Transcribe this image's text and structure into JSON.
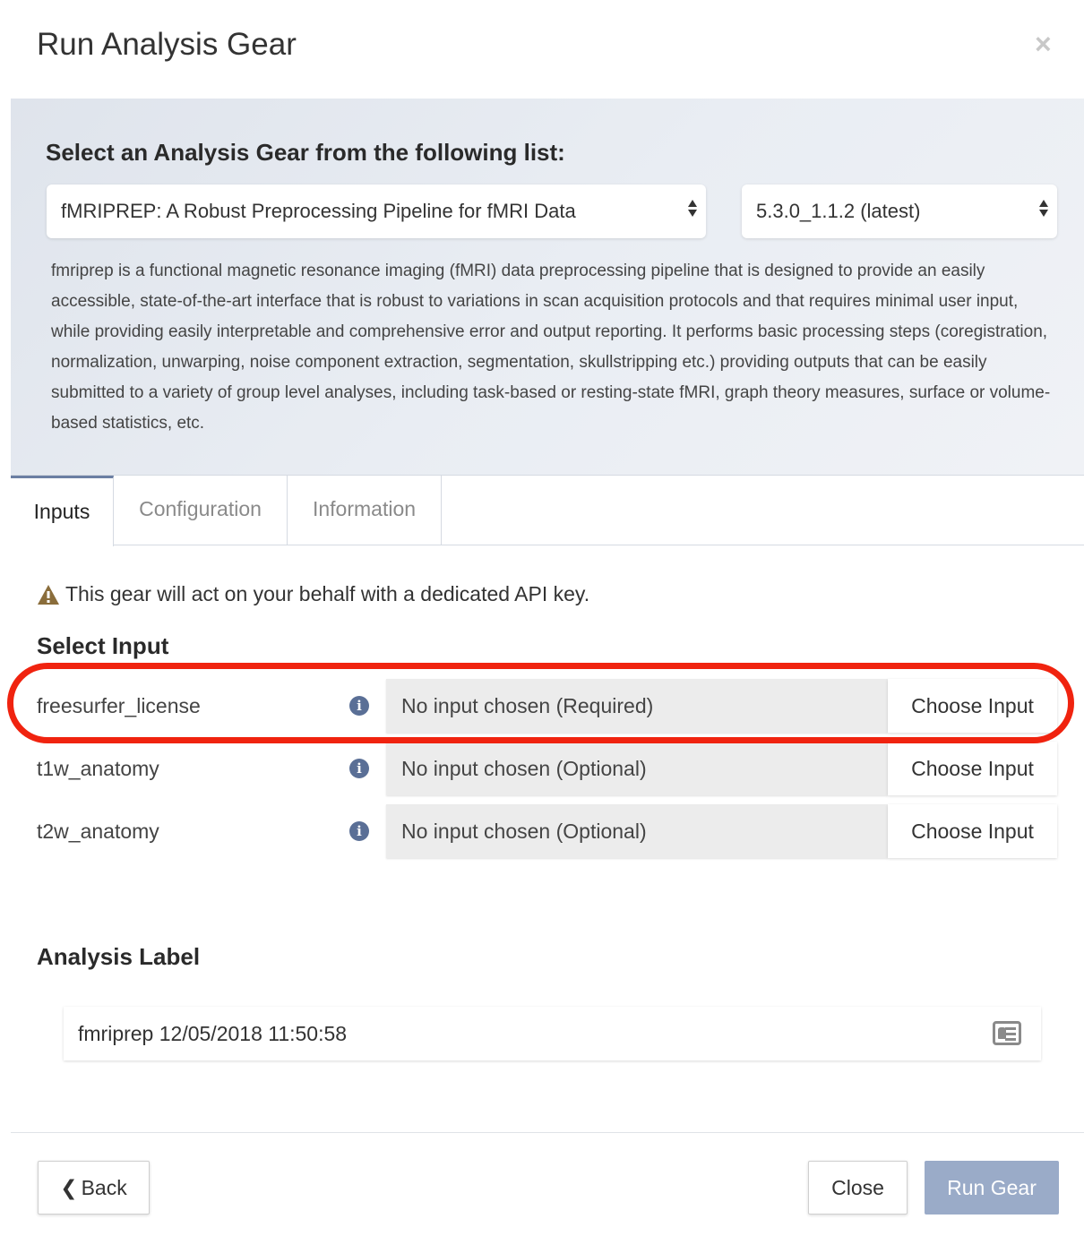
{
  "modal": {
    "title": "Run Analysis Gear",
    "close_glyph": "×"
  },
  "gear_select": {
    "heading": "Select an Analysis Gear from the following list:",
    "gear_value": "fMRIPREP: A Robust Preprocessing Pipeline for fMRI Data",
    "version_value": "5.3.0_1.1.2 (latest)",
    "description": "fmriprep is a functional magnetic resonance imaging (fMRI) data preprocessing pipeline that is designed to provide an easily accessible, state-of-the-art interface that is robust to variations in scan acquisition protocols and that requires minimal user input, while providing easily interpretable and comprehensive error and output reporting. It performs basic processing steps (coregistration, normalization, unwarping, noise component extraction, segmentation, skullstripping etc.) providing outputs that can be easily submitted to a variety of group level analyses, including task-based or resting-state fMRI, graph theory measures, surface or volume-based statistics, etc."
  },
  "tabs": [
    {
      "label": "Inputs",
      "active": true
    },
    {
      "label": "Configuration",
      "active": false
    },
    {
      "label": "Information",
      "active": false
    }
  ],
  "warning": {
    "icon": "warning-triangle-icon",
    "text": "This gear will act on your behalf with a dedicated API key."
  },
  "select_input": {
    "title": "Select Input",
    "rows": [
      {
        "name": "freesurfer_license",
        "status": "No input chosen (Required)",
        "button": "Choose Input"
      },
      {
        "name": "t1w_anatomy",
        "status": "No input chosen (Optional)",
        "button": "Choose Input"
      },
      {
        "name": "t2w_anatomy",
        "status": "No input chosen (Optional)",
        "button": "Choose Input"
      }
    ]
  },
  "analysis_label": {
    "title": "Analysis Label",
    "value": "fmriprep 12/05/2018 11:50:58",
    "icon": "id-card-icon"
  },
  "footer": {
    "back_label": "Back",
    "close_label": "Close",
    "run_label": "Run Gear"
  },
  "colors": {
    "highlight": "#f0230f",
    "run_button": "#9aabc8",
    "info_icon": "#5a6f96",
    "warning_icon": "#8a6d3b"
  }
}
